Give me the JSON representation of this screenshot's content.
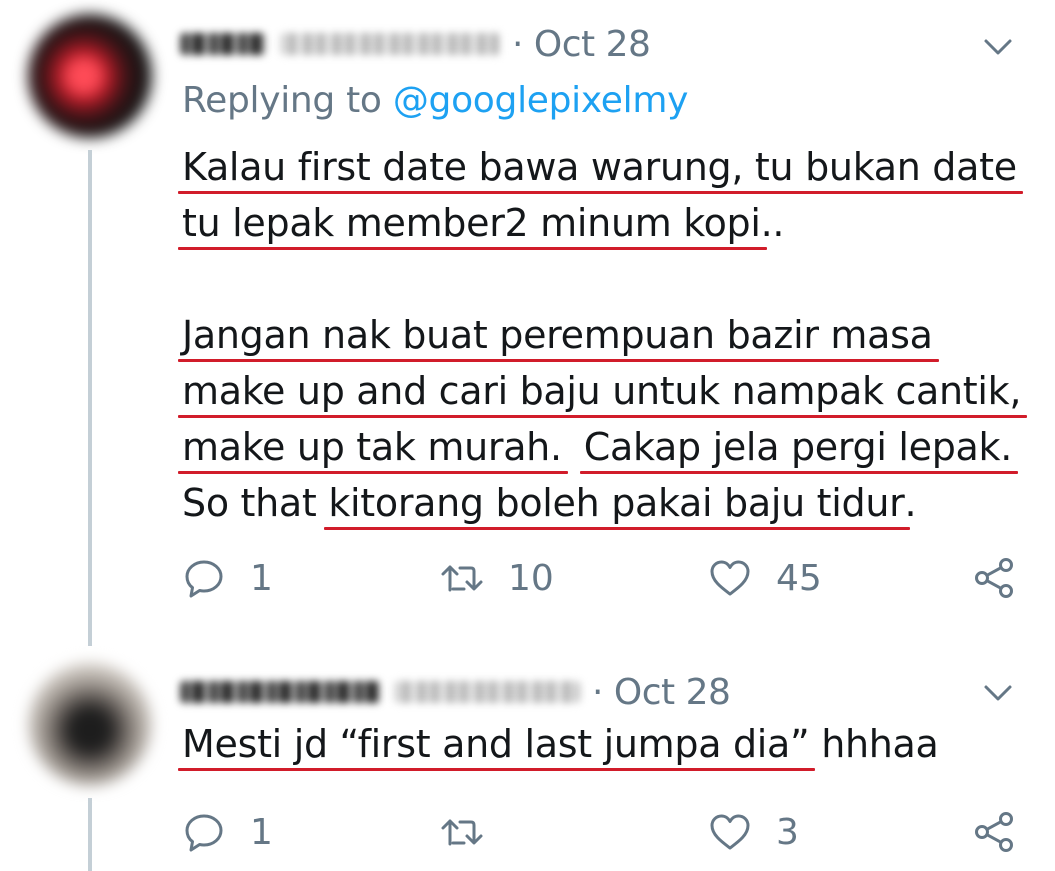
{
  "tweets": [
    {
      "date": "· Oct 28",
      "replying_prefix": "Replying to ",
      "replying_handle": "@googlepixelmy",
      "lines": {
        "l1": "Kalau first date bawa warung, tu bukan date",
        "l2a": "tu lepak member2 minum kopi",
        "l2b": "..",
        "l3": "Jangan nak buat perempuan bazir masa",
        "l4": "make up and cari baju untuk nampak cantik,",
        "l5a": "make up tak murah.",
        "l5b": " ",
        "l5c": "Cakap jela pergi lepak.",
        "l6a": "So that ",
        "l6b": "kitorang boleh pakai baju tidur",
        "l6c": "."
      },
      "counts": {
        "reply": "1",
        "retweet": "10",
        "like": "45"
      }
    },
    {
      "date": "· Oct 28",
      "lines": {
        "l1a": "Mesti jd “first and last jumpa dia”",
        "l1b": " hhhaa"
      },
      "counts": {
        "reply": "1",
        "retweet": "",
        "like": "3"
      }
    }
  ],
  "icons": {
    "reply": "reply-icon",
    "retweet": "retweet-icon",
    "like": "heart-icon",
    "share": "share-icon",
    "menu": "chevron-down-icon"
  },
  "colors": {
    "muted": "#657786",
    "link": "#1da1f2",
    "text": "#14171a",
    "underline": "#d11c2a",
    "thread": "#c4cfd6"
  }
}
